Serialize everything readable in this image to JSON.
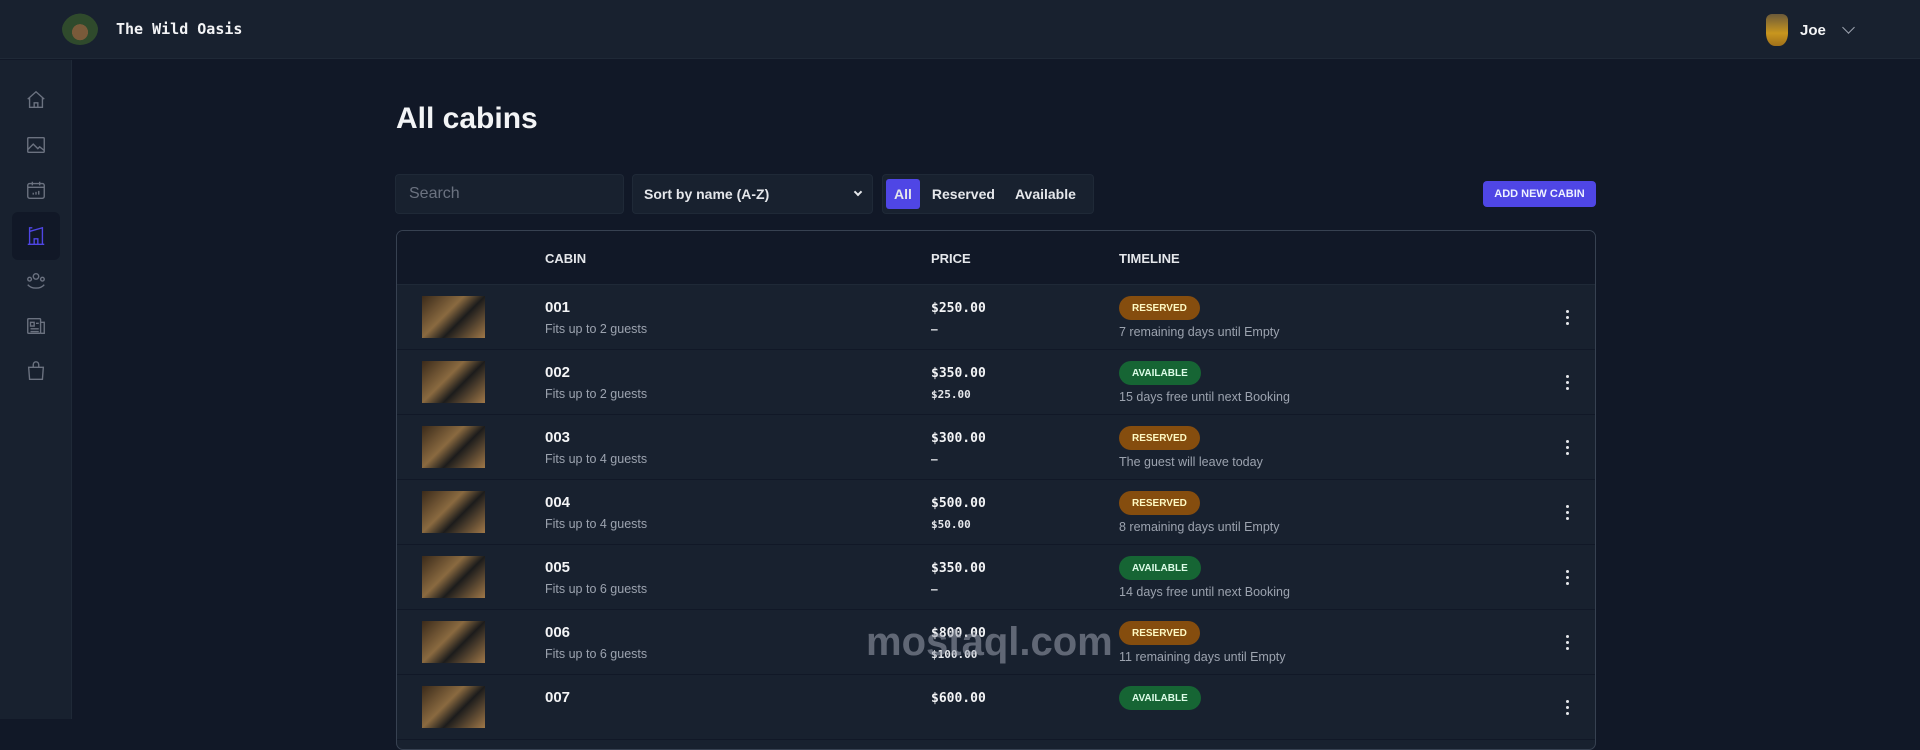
{
  "header": {
    "brand": "The Wild Oasis",
    "user_name": "Joe"
  },
  "sidebar": {
    "items": [
      {
        "icon": "home-icon"
      },
      {
        "icon": "image-icon"
      },
      {
        "icon": "calendar-icon"
      },
      {
        "icon": "cabin-icon",
        "active": true
      },
      {
        "icon": "users-icon"
      },
      {
        "icon": "newspaper-icon"
      },
      {
        "icon": "shopping-bag-icon"
      }
    ]
  },
  "page": {
    "title": "All cabins"
  },
  "controls": {
    "search_placeholder": "Search",
    "sort_value": "Sort by name (A-Z)",
    "filters": [
      "All",
      "Reserved",
      "Available"
    ],
    "active_filter": "All",
    "add_button": "ADD NEW CABIN"
  },
  "table": {
    "columns": [
      "CABIN",
      "PRICE",
      "TIMELINE"
    ],
    "rows": [
      {
        "name": "001",
        "capacity": "Fits up to 2 guests",
        "price": "$250.00",
        "discount": "—",
        "status": "RESERVED",
        "timeline": "7 remaining days until Empty"
      },
      {
        "name": "002",
        "capacity": "Fits up to 2 guests",
        "price": "$350.00",
        "discount": "$25.00",
        "status": "AVAILABLE",
        "timeline": "15 days free until next Booking"
      },
      {
        "name": "003",
        "capacity": "Fits up to 4 guests",
        "price": "$300.00",
        "discount": "—",
        "status": "RESERVED",
        "timeline": "The guest will leave today"
      },
      {
        "name": "004",
        "capacity": "Fits up to 4 guests",
        "price": "$500.00",
        "discount": "$50.00",
        "status": "RESERVED",
        "timeline": "8 remaining days until Empty"
      },
      {
        "name": "005",
        "capacity": "Fits up to 6 guests",
        "price": "$350.00",
        "discount": "—",
        "status": "AVAILABLE",
        "timeline": "14 days free until next Booking"
      },
      {
        "name": "006",
        "capacity": "Fits up to 6 guests",
        "price": "$800.00",
        "discount": "$100.00",
        "status": "RESERVED",
        "timeline": "11 remaining days until Empty"
      },
      {
        "name": "007",
        "capacity": "",
        "price": "$600.00",
        "discount": "",
        "status": "AVAILABLE",
        "timeline": ""
      }
    ]
  },
  "watermark": "mostaql.com",
  "colors": {
    "accent": "#4f46e5",
    "reserved": "#854d0e",
    "available": "#166534",
    "background": "#111827",
    "panel": "#18212f"
  }
}
